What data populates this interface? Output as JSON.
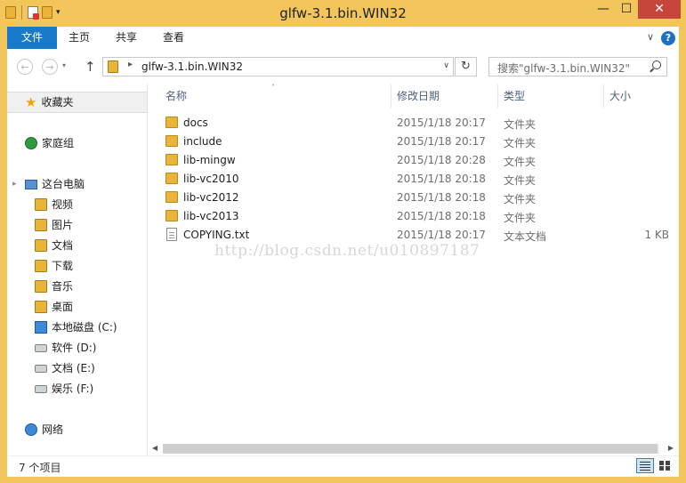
{
  "window": {
    "title": "glfw-3.1.bin.WIN32",
    "min_glyph": "—",
    "max_glyph": "☐",
    "close_glyph": "✕"
  },
  "ribbon": {
    "tabs": [
      "文件",
      "主页",
      "共享",
      "查看"
    ],
    "collapse_glyph": "∨",
    "help_glyph": "?"
  },
  "address": {
    "path": "glfw-3.1.bin.WIN32",
    "back_glyph": "←",
    "forward_glyph": "→",
    "recent_glyph": "▾",
    "up_glyph": "↑",
    "sep_glyph": "▸",
    "dropdown_glyph": "∨",
    "refresh_glyph": "↻",
    "search_placeholder": "搜索\"glfw-3.1.bin.WIN32\""
  },
  "nav": {
    "favorites": "收藏夹",
    "homegroup": "家庭组",
    "thispc": "这台电脑",
    "pc_items": [
      "视频",
      "图片",
      "文档",
      "下载",
      "音乐",
      "桌面"
    ],
    "drives": [
      "本地磁盘 (C:)",
      "软件 (D:)",
      "文档 (E:)",
      "娱乐 (F:)"
    ],
    "network": "网络",
    "expand_glyph": "▸"
  },
  "columns": {
    "name": "名称",
    "modified": "修改日期",
    "type": "类型",
    "size": "大小",
    "sort_glyph": "˄"
  },
  "files": [
    {
      "name": "docs",
      "modified": "2015/1/18 20:17",
      "type": "文件夹",
      "size": "",
      "icon": "folder"
    },
    {
      "name": "include",
      "modified": "2015/1/18 20:17",
      "type": "文件夹",
      "size": "",
      "icon": "folder"
    },
    {
      "name": "lib-mingw",
      "modified": "2015/1/18 20:28",
      "type": "文件夹",
      "size": "",
      "icon": "folder"
    },
    {
      "name": "lib-vc2010",
      "modified": "2015/1/18 20:18",
      "type": "文件夹",
      "size": "",
      "icon": "folder"
    },
    {
      "name": "lib-vc2012",
      "modified": "2015/1/18 20:18",
      "type": "文件夹",
      "size": "",
      "icon": "folder"
    },
    {
      "name": "lib-vc2013",
      "modified": "2015/1/18 20:18",
      "type": "文件夹",
      "size": "",
      "icon": "folder"
    },
    {
      "name": "COPYING.txt",
      "modified": "2015/1/18 20:17",
      "type": "文本文档",
      "size": "1 KB",
      "icon": "text-file"
    }
  ],
  "watermark": "http://blog.csdn.net/u010897187",
  "status": {
    "item_count": "7 个项目"
  },
  "scroll": {
    "left_glyph": "◀",
    "right_glyph": "▶"
  },
  "colors": {
    "frame": "#f2c65a",
    "file_tab": "#1979ca",
    "close_button": "#c7463b",
    "folder": "#e8b53a"
  }
}
